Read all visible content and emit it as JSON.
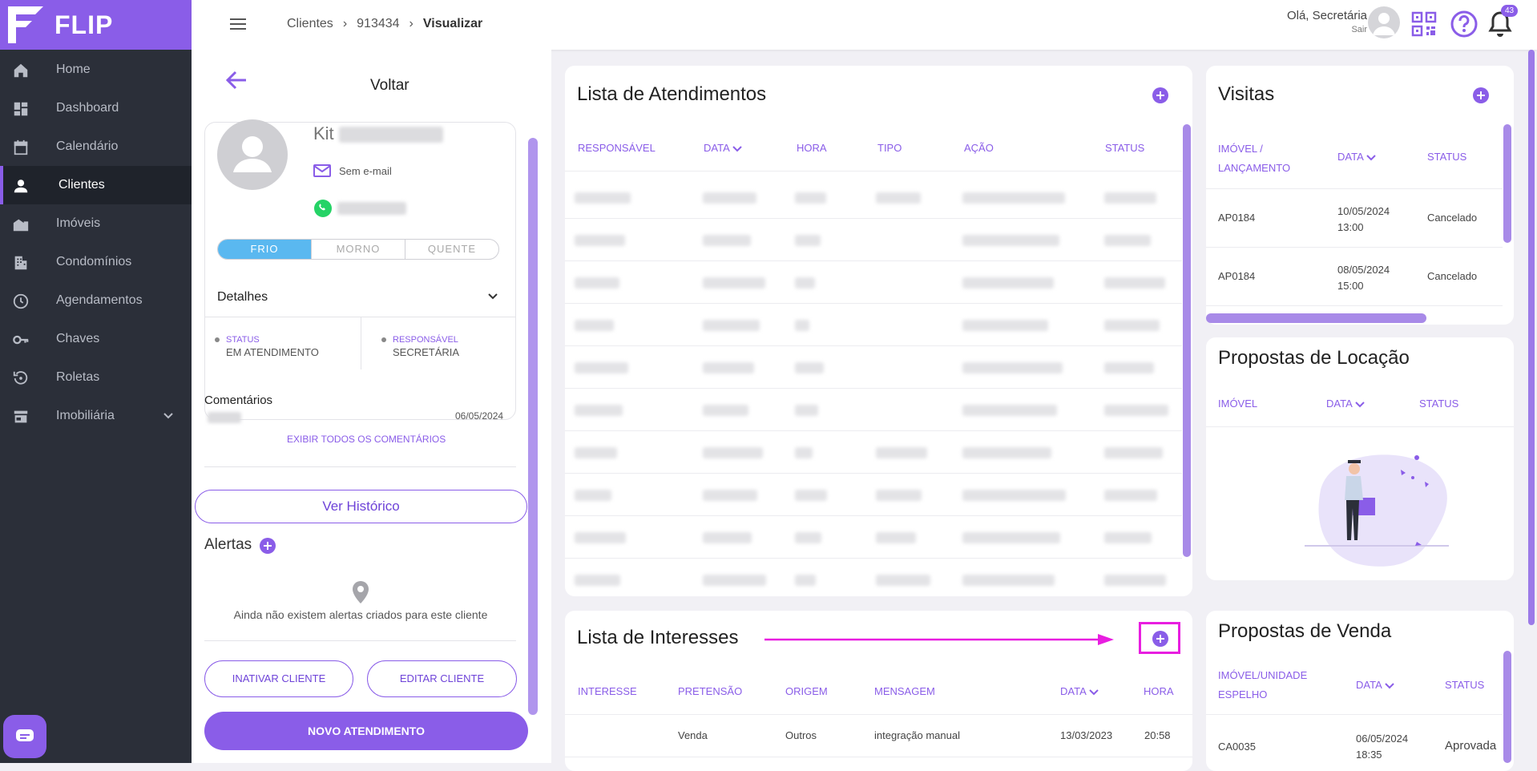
{
  "app": {
    "brand": "FLIP"
  },
  "sidebar": {
    "items": [
      {
        "label": "Home",
        "icon": "home-icon"
      },
      {
        "label": "Dashboard",
        "icon": "dashboard-icon"
      },
      {
        "label": "Calendário",
        "icon": "calendar-icon"
      },
      {
        "label": "Clientes",
        "icon": "user-icon",
        "active": true
      },
      {
        "label": "Imóveis",
        "icon": "building-icon"
      },
      {
        "label": "Condomínios",
        "icon": "condo-icon"
      },
      {
        "label": "Agendamentos",
        "icon": "clock-icon"
      },
      {
        "label": "Chaves",
        "icon": "key-icon"
      },
      {
        "label": "Roletas",
        "icon": "roulette-icon"
      },
      {
        "label": "Imobiliária",
        "icon": "store-icon"
      }
    ]
  },
  "header": {
    "breadcrumb": [
      "Clientes",
      "913434",
      "Visualizar"
    ],
    "greeting": "Olá, Secretária",
    "logout": "Sair",
    "notifications": "43"
  },
  "client": {
    "back_label": "Voltar",
    "name_first": "Kit",
    "email": "Sem e-mail",
    "temperature": [
      "FRIO",
      "MORNO",
      "QUENTE"
    ],
    "details_title": "Detalhes",
    "status_label": "STATUS",
    "status_value": "EM ATENDIMENTO",
    "responsible_label": "RESPONSÁVEL",
    "responsible_value": "SECRETÁRIA",
    "comments_title": "Comentários",
    "comment_date": "06/05/2024",
    "show_all_comments": "EXIBIR TODOS OS COMENTÁRIOS",
    "history_button": "Ver Histórico",
    "alerts_title": "Alertas",
    "no_alerts": "Ainda não existem alertas criados para este cliente",
    "deactivate_button": "INATIVAR CLIENTE",
    "edit_button": "EDITAR CLIENTE",
    "new_button": "NOVO ATENDIMENTO"
  },
  "atendimentos": {
    "title": "Lista de Atendimentos",
    "columns": [
      "RESPONSÁVEL",
      "DATA",
      "HORA",
      "TIPO",
      "AÇÃO",
      "STATUS"
    ]
  },
  "interesses": {
    "title": "Lista de Interesses",
    "columns": [
      "INTERESSE",
      "PRETENSÃO",
      "ORIGEM",
      "MENSAGEM",
      "DATA",
      "HORA"
    ],
    "rows": [
      {
        "interesse": "",
        "pretensao": "Venda",
        "origem": "Outros",
        "mensagem": "integração manual",
        "data": "13/03/2023",
        "hora": "20:58"
      }
    ]
  },
  "visitas": {
    "title": "Visitas",
    "columns": [
      "IMÓVEL /",
      "LANÇAMENTO",
      "DATA",
      "STATUS"
    ],
    "rows": [
      {
        "imovel": "AP0184",
        "data": "10/05/2024",
        "hora": "13:00",
        "status": "Cancelado"
      },
      {
        "imovel": "AP0184",
        "data": "08/05/2024",
        "hora": "15:00",
        "status": "Cancelado"
      }
    ]
  },
  "locacao": {
    "title": "Propostas de Locação",
    "columns": [
      "IMÓVEL",
      "DATA",
      "STATUS"
    ]
  },
  "venda": {
    "title": "Propostas de Venda",
    "columns": [
      "IMÓVEL/UNIDADE",
      "ESPELHO",
      "DATA",
      "STATUS"
    ],
    "rows": [
      {
        "imovel": "CA0035",
        "data": "06/05/2024",
        "hora": "18:35",
        "status": "Aprovada"
      }
    ]
  },
  "colors": {
    "accent": "#8a5de8",
    "sidebar": "#2b2f39",
    "annotation": "#e81ee0",
    "cold": "#5ab8f0"
  }
}
